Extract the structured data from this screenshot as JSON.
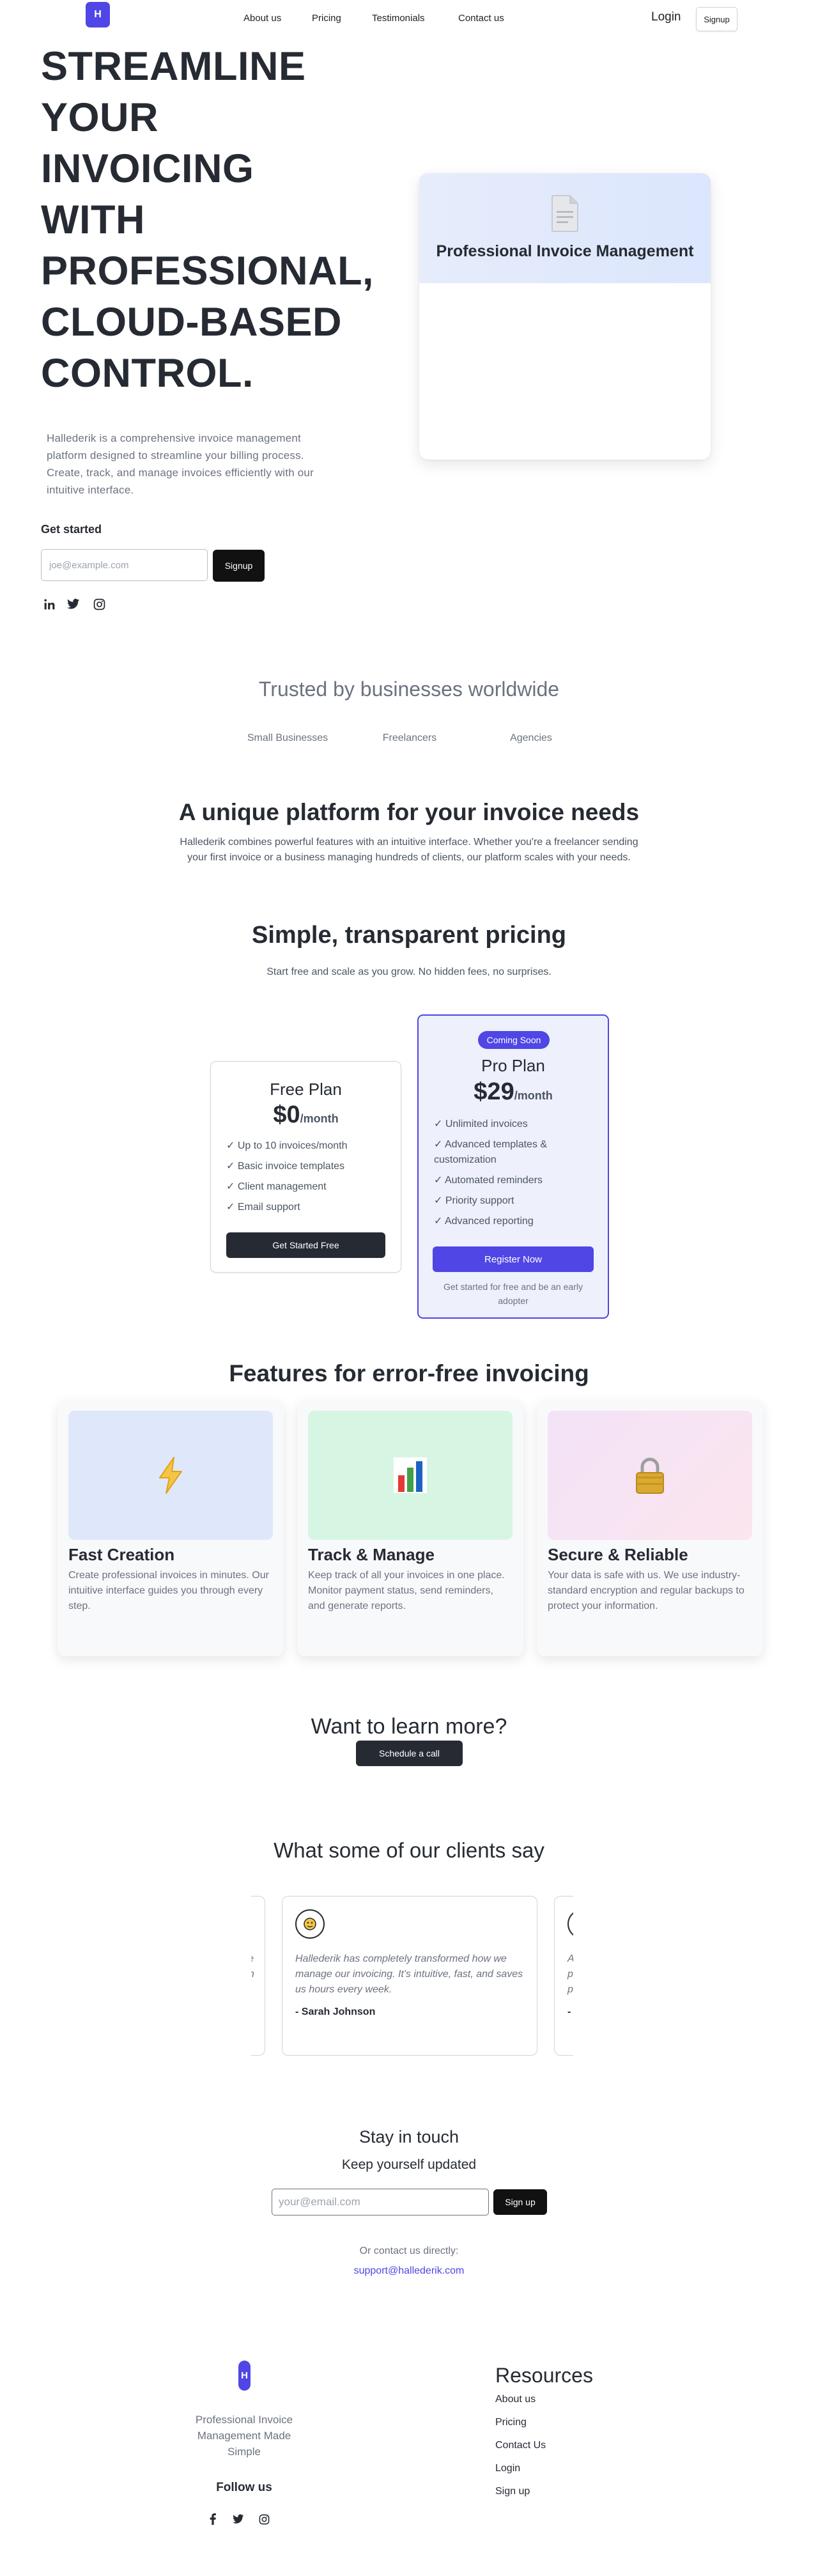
{
  "nav": {
    "logo_letter": "H",
    "links": [
      "About us",
      "Pricing",
      "Testimonials",
      "Contact us"
    ],
    "login": "Login",
    "signup": "Signup"
  },
  "hero": {
    "title_lines": [
      "STREAMLINE",
      "YOUR",
      "INVOICING",
      "WITH",
      "PROFESSIONAL,",
      "CLOUD-BASED",
      "CONTROL."
    ],
    "description": "Hallederik is a comprehensive invoice management platform designed to streamline your billing process. Create, track, and manage invoices efficiently with our intuitive interface.",
    "get_started": "Get started",
    "email_placeholder": "joe@example.com",
    "signup": "Signup",
    "social_icons": [
      "linkedin-icon",
      "twitter-icon",
      "instagram-icon"
    ],
    "card_title": "Professional Invoice Management"
  },
  "trusted": {
    "title": "Trusted by businesses worldwide",
    "items": [
      "Small Businesses",
      "Freelancers",
      "Agencies"
    ]
  },
  "unique": {
    "title": "A unique platform for your invoice needs",
    "description": "Hallederik combines powerful features with an intuitive interface. Whether you're a freelancer sending your first invoice or a business managing hundreds of clients, our platform scales with your needs."
  },
  "pricing": {
    "title": "Simple, transparent pricing",
    "subtitle": "Start free and scale as you grow. No hidden fees, no surprises.",
    "free": {
      "name": "Free Plan",
      "price": "$0",
      "period": "/month",
      "features": [
        "✓ Up to 10 invoices/month",
        "✓ Basic invoice templates",
        "✓ Client management",
        "✓ Email support"
      ],
      "button": "Get Started Free"
    },
    "pro": {
      "badge": "Coming Soon",
      "name": "Pro Plan",
      "price": "$29",
      "period": "/month",
      "features": [
        "✓ Unlimited invoices",
        "✓ Advanced templates & customization",
        "✓ Automated reminders",
        "✓ Priority support",
        "✓ Advanced reporting"
      ],
      "button": "Register Now",
      "note": "Get started for free and be an early adopter"
    }
  },
  "features": {
    "title": "Features for error-free invoicing",
    "cards": [
      {
        "icon": "⚡",
        "title": "Fast Creation",
        "description": "Create professional invoices in minutes. Our intuitive interface guides you through every step.",
        "bg": "#dfe7fb"
      },
      {
        "icon": "📊",
        "title": "Track & Manage",
        "description": "Keep track of all your invoices in one place. Monitor payment status, send reminders, and generate reports.",
        "bg": "#d6f6e3"
      },
      {
        "icon": "🔒",
        "title": "Secure & Reliable",
        "description": "Your data is safe with us. We use industry-standard encryption and regular backups to protect your information.",
        "bg": "#f6e2f3"
      }
    ]
  },
  "learn": {
    "title": "Want to learn more?",
    "button": "Schedule a call"
  },
  "testimonials": {
    "title": "What some of our clients say",
    "items": [
      {
        "quote": "Hallederik has completely transformed how we manage our invoicing. It's intuitive, fast, and saves us hours every week.",
        "author": "- Sarah Johnson"
      }
    ],
    "left_partial": [
      "ve",
      "an"
    ],
    "right_partial": [
      "As",
      "pc",
      "pr",
      "- I"
    ]
  },
  "stay": {
    "title": "Stay in touch",
    "subtitle": "Keep yourself updated",
    "placeholder": "your@email.com",
    "button": "Sign up",
    "contact_label": "Or contact us directly:",
    "email": "support@hallederik.com"
  },
  "footer": {
    "logo_letter": "H",
    "tagline": "Professional Invoice Management Made Simple",
    "follow": "Follow us",
    "resources_title": "Resources",
    "resources": [
      "About us",
      "Pricing",
      "Contact Us",
      "Login",
      "Sign up"
    ]
  },
  "colors": {
    "accent": "#4f46e5",
    "dark": "#262b33",
    "muted": "#6b7280"
  }
}
